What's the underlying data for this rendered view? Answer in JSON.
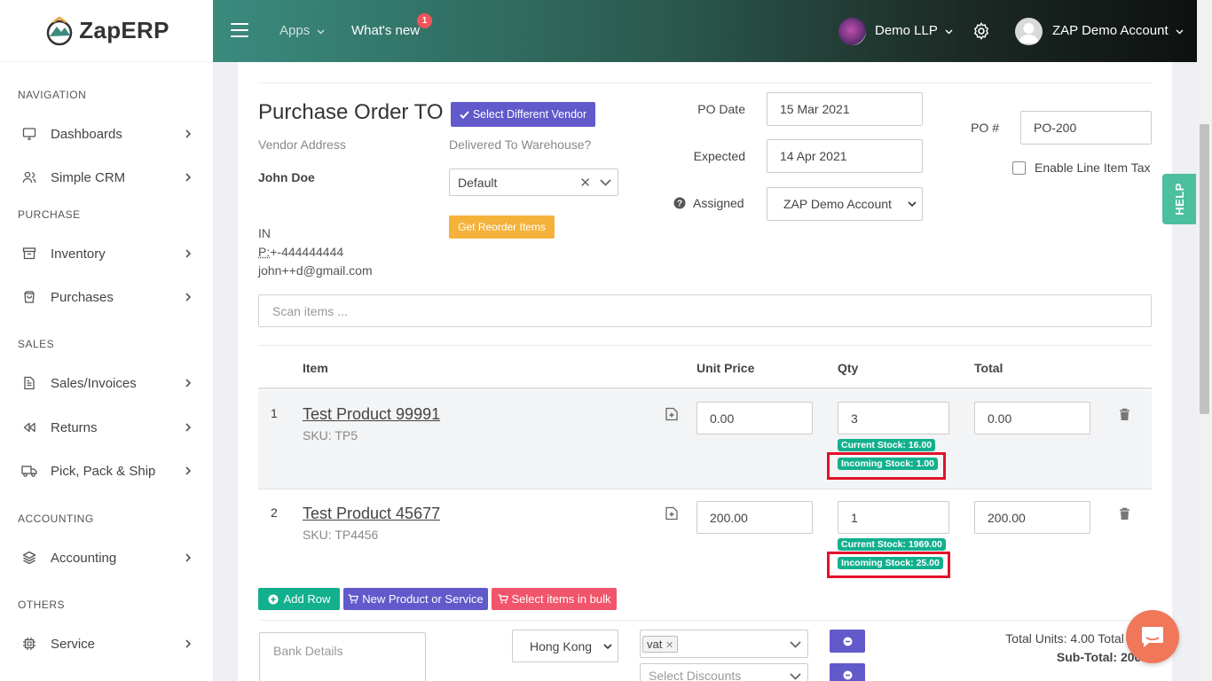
{
  "brand": {
    "name": "ZapERP"
  },
  "sidebar": {
    "sections": [
      {
        "label": "NAVIGATION"
      },
      {
        "label": "PURCHASE"
      },
      {
        "label": "SALES"
      },
      {
        "label": "ACCOUNTING"
      },
      {
        "label": "OTHERS"
      }
    ],
    "items": [
      {
        "label": "Dashboards",
        "icon": "monitor-icon"
      },
      {
        "label": "Simple CRM",
        "icon": "users-icon"
      },
      {
        "label": "Inventory",
        "icon": "archive-icon"
      },
      {
        "label": "Purchases",
        "icon": "shopping-bag-icon"
      },
      {
        "label": "Sales/Invoices",
        "icon": "file-text-icon"
      },
      {
        "label": "Returns",
        "icon": "rewind-icon"
      },
      {
        "label": "Pick, Pack & Ship",
        "icon": "truck-icon"
      },
      {
        "label": "Accounting",
        "icon": "layers-icon"
      },
      {
        "label": "Service",
        "icon": "cpu-icon"
      }
    ]
  },
  "header": {
    "apps": "Apps",
    "whats_new": "What's new",
    "whats_new_count": "1",
    "company": "Demo LLP",
    "user": "ZAP Demo Account"
  },
  "po": {
    "title": "Purchase Order TO",
    "select_vendor": "Select Different Vendor",
    "vendor_address_label": "Vendor Address",
    "vendor_name": "John Doe",
    "vendor_country": "IN",
    "vendor_phone_prefix": "P:",
    "vendor_phone": "+-444444444",
    "vendor_email": "john++d@gmail.com",
    "delivered_label": "Delivered To Warehouse?",
    "warehouse": "Default",
    "reorder_button": "Get Reorder Items",
    "po_date_label": "PO Date",
    "po_date": "15 Mar 2021",
    "expected_label": "Expected",
    "expected": "14 Apr 2021",
    "assigned_label": "Assigned",
    "assigned": "ZAP Demo Account",
    "po_number_label": "PO #",
    "po_number": "PO-200",
    "line_tax_label": "Enable Line Item Tax",
    "scan_placeholder": "Scan items ..."
  },
  "table": {
    "headers": {
      "item": "Item",
      "unit_price": "Unit Price",
      "qty": "Qty",
      "total": "Total"
    },
    "rows": [
      {
        "num": "1",
        "name": "Test Product 99991",
        "sku": "SKU: TP5",
        "price": "0.00",
        "qty": "3",
        "total": "0.00",
        "current_stock": "Current Stock: 16.00",
        "incoming_stock": "Incoming Stock: 1.00"
      },
      {
        "num": "2",
        "name": "Test Product 45677",
        "sku": "SKU: TP4456",
        "price": "200.00",
        "qty": "1",
        "total": "200.00",
        "current_stock": "Current Stock: 1969.00",
        "incoming_stock": "Incoming Stock: 25.00"
      }
    ]
  },
  "actions": {
    "add_row": "Add Row",
    "new_product": "New Product or Service",
    "bulk": "Select items in bulk"
  },
  "footer": {
    "bank_placeholder": "Bank Details",
    "region": "Hong Kong",
    "tax_tag": "vat",
    "discount_placeholder": "Select Discounts",
    "total_units": "Total Units: 4.00 Total Item",
    "subtotal": "Sub-Total: 200.0"
  },
  "help": "HELP",
  "colors": {
    "accent_purple": "#6259ca",
    "accent_green": "#13b08e",
    "accent_red": "#f1556b",
    "highlight": "#e2132a"
  }
}
